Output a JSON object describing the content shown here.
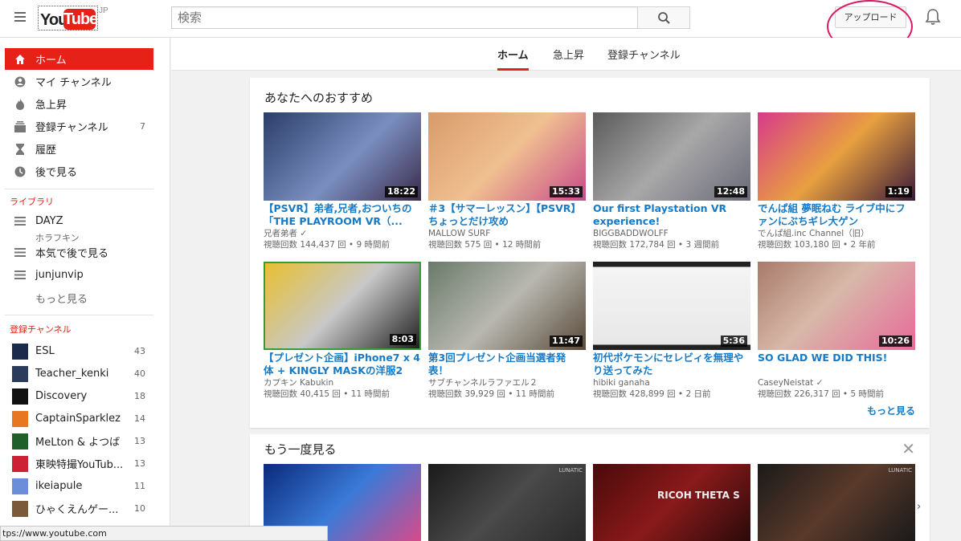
{
  "header": {
    "logo_you": "You",
    "logo_tube": "Tube",
    "logo_region": "JP",
    "search_placeholder": "検索",
    "upload_label": "アップロード"
  },
  "sidebar": {
    "nav": [
      {
        "label": "ホーム",
        "icon": "home-icon"
      },
      {
        "label": "マイ チャンネル",
        "icon": "account-icon"
      },
      {
        "label": "急上昇",
        "icon": "flame-icon"
      },
      {
        "label": "登録チャンネル",
        "icon": "subscriptions-icon",
        "count": "7"
      },
      {
        "label": "履歴",
        "icon": "hourglass-icon"
      },
      {
        "label": "後で見る",
        "icon": "clock-icon"
      }
    ],
    "library_title": "ライブラリ",
    "library": [
      {
        "label": "DAYZ",
        "sub": "ホラフキン",
        "icon": "playlist-icon"
      },
      {
        "label": "本気で後で見る",
        "icon": "playlist-icon"
      },
      {
        "label": "junjunvip",
        "icon": "playlist-icon"
      }
    ],
    "library_more": "もっと見る",
    "subs_title": "登録チャンネル",
    "channels": [
      {
        "label": "ESL",
        "count": "43",
        "color": "#1b2a4a"
      },
      {
        "label": "Teacher_kenki",
        "count": "40",
        "color": "#2a3b5c"
      },
      {
        "label": "Discovery",
        "count": "18",
        "color": "#111111"
      },
      {
        "label": "CaptainSparklez",
        "count": "14",
        "color": "#e87722"
      },
      {
        "label": "MeLton & よつば",
        "count": "13",
        "color": "#1f5f2a"
      },
      {
        "label": "東映特撮YouTub...",
        "count": "13",
        "color": "#cc2233"
      },
      {
        "label": "ikeiapule",
        "count": "11",
        "color": "#6a8fd8"
      },
      {
        "label": "ひゃくえんゲー...",
        "count": "10",
        "color": "#7a5a3a"
      }
    ]
  },
  "tabs": [
    {
      "label": "ホーム"
    },
    {
      "label": "急上昇"
    },
    {
      "label": "登録チャンネル"
    }
  ],
  "recommended": {
    "title": "あなたへのおすすめ",
    "more_label": "もっと見る",
    "videos": [
      {
        "title": "【PSVR】弟者,兄者,おついちの「THE PLAYROOM VR（...",
        "channel": "兄者弟者 ✓",
        "meta": "視聴回数 144,437 回 • 9 時間前",
        "duration": "18:22",
        "color": "#4a5d8a"
      },
      {
        "title": "＃3【サマーレッスン】【PSVR】ちょっとだけ攻め",
        "channel": "MALLOW SURF",
        "meta": "視聴回数 575 回 • 12 時間前",
        "duration": "15:33",
        "color": "#c87a4a"
      },
      {
        "title": "Our first Playstation VR experience!",
        "channel": "BIGGBADDWOLFF",
        "meta": "視聴回数 172,784 回 • 3 週間前",
        "duration": "12:48",
        "color": "#6a6a6a"
      },
      {
        "title": "でんぱ組 夢眠ねむ ライブ中にファンにぶちギレ大ゲン",
        "channel": "でんぱ組.inc Channel（旧）",
        "meta": "視聴回数 103,180 回 • 2 年前",
        "duration": "1:19",
        "color": "#c83a7a"
      },
      {
        "title": "【プレゼント企画】iPhone7 x 4体 + KINGLY MASKの洋服2",
        "channel": "カプキン Kabukin",
        "meta": "視聴回数 40,415 回 • 11 時間前",
        "duration": "8:03",
        "color": "#d8a020"
      },
      {
        "title": "第3回プレゼント企画当選者発表！",
        "channel": "サブチャンネルラファエル２",
        "meta": "視聴回数 39,929 回 • 11 時間前",
        "duration": "11:47",
        "color": "#8a8a8a"
      },
      {
        "title": "初代ポケモンにセレビィを無理やり送ってみた",
        "channel": "hibiki ganaha",
        "meta": "視聴回数 428,899 回 • 2 日前",
        "duration": "5:36",
        "color": "#e8e8e8"
      },
      {
        "title": "SO GLAD WE DID THIS!",
        "channel": "CaseyNeistat ✓",
        "meta": "視聴回数 226,317 回 • 5 時間前",
        "duration": "10:26",
        "color": "#b07a6a"
      }
    ]
  },
  "watch_again": {
    "title": "もう一度見る",
    "thumbs": [
      "#1a3a8a",
      "#2a2a2a",
      "#6a1a1a",
      "#3a2a2a"
    ],
    "labels": [
      "",
      "LUNATIC",
      "RICOH THETA S",
      "LUNATIC"
    ]
  },
  "status_bar": "tps://www.youtube.com"
}
